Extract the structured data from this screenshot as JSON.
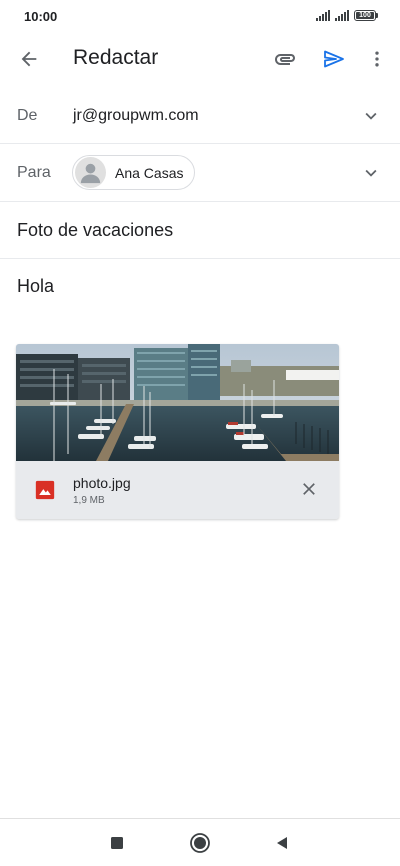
{
  "status_bar": {
    "time": "10:00",
    "battery": "100",
    "battery_level": 1.0,
    "icons": [
      "signal-icon",
      "signal-icon",
      "battery-icon"
    ]
  },
  "app_bar": {
    "title": "Redactar",
    "icons": [
      "back-arrow-icon",
      "attach-icon",
      "send-icon",
      "more-vert-icon"
    ],
    "send_color": "#1a73e8"
  },
  "compose": {
    "from_label": "De",
    "from_value": "jr@groupwm.com",
    "to_label": "Para",
    "to_chips": [
      {
        "name": "Ana Casas",
        "icon": "person-avatar-icon"
      }
    ],
    "subject": "Foto de vacaciones",
    "body": "Hola"
  },
  "attachment": {
    "file_name": "photo.jpg",
    "file_size": "1,9 MB",
    "icon": "image-file-icon",
    "icon_color": "#d93025",
    "remove_icon": "close-icon"
  },
  "nav_bar": {
    "icons": [
      "recents-square-icon",
      "home-circle-icon",
      "back-triangle-icon"
    ]
  }
}
